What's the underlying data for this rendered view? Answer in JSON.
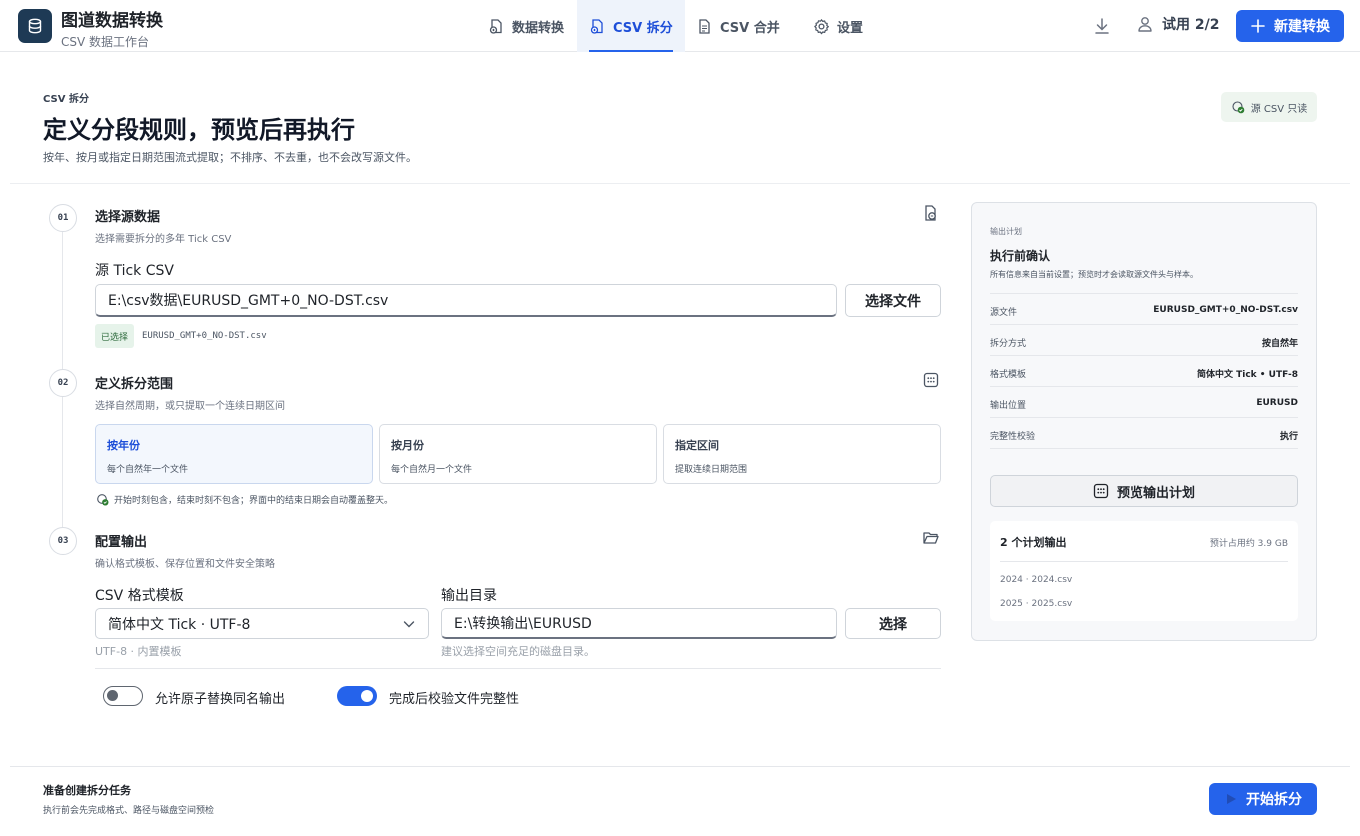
{
  "header": {
    "app_name": "图道数据转换",
    "app_sub": "CSV 数据工作台",
    "tabs": [
      {
        "label": "数据转换",
        "icon": "file-convert-icon"
      },
      {
        "label": "CSV 拆分",
        "icon": "file-split-icon",
        "active": true
      },
      {
        "label": "CSV 合并",
        "icon": "file-merge-icon"
      },
      {
        "label": "设置",
        "icon": "gear-icon"
      }
    ],
    "trial": "试用 2/2",
    "new_button": "新建转换"
  },
  "page": {
    "eyebrow": "CSV 拆分",
    "title": "定义分段规则，预览后再执行",
    "desc": "按年、按月或指定日期范围流式提取；不排序、不去重，也不会改写源文件。",
    "badge": "源 CSV 只读"
  },
  "step1": {
    "num": "01",
    "title": "选择源数据",
    "desc": "选择需要拆分的多年 Tick CSV",
    "field_label": "源 Tick CSV",
    "path_value": "E:\\csv数据\\EURUSD_GMT+0_NO-DST.csv",
    "choose_button": "选择文件",
    "selected_tag": "已选择",
    "selected_file": "EURUSD_GMT+0_NO-DST.csv"
  },
  "step2": {
    "num": "02",
    "title": "定义拆分范围",
    "desc": "选择自然周期，或只提取一个连续日期区间",
    "options": [
      {
        "title": "按年份",
        "desc": "每个自然年一个文件",
        "active": true
      },
      {
        "title": "按月份",
        "desc": "每个自然月一个文件"
      },
      {
        "title": "指定区间",
        "desc": "提取连续日期范围"
      }
    ],
    "note": "开始时刻包含，结束时刻不包含；界面中的结束日期会自动覆盖整天。"
  },
  "step3": {
    "num": "03",
    "title": "配置输出",
    "desc": "确认格式模板、保存位置和文件安全策略",
    "template_label": "CSV 格式模板",
    "template_value": "简体中文 Tick · UTF-8",
    "template_hint": "UTF-8 · 内置模板",
    "dir_label": "输出目录",
    "dir_value": "E:\\转换输出\\EURUSD",
    "dir_button": "选择",
    "dir_hint": "建议选择空间充足的磁盘目录。",
    "toggle1_label": "允许原子替换同名输出",
    "toggle1_on": false,
    "toggle2_label": "完成后校验文件完整性",
    "toggle2_on": true
  },
  "plan": {
    "eyebrow": "输出计划",
    "title": "执行前确认",
    "desc": "所有信息来自当前设置；预览时才会读取源文件头与样本。",
    "rows": [
      {
        "key": "源文件",
        "value": "EURUSD_GMT+0_NO-DST.csv"
      },
      {
        "key": "拆分方式",
        "value": "按自然年"
      },
      {
        "key": "格式模板",
        "value": "简体中文 Tick • UTF-8"
      },
      {
        "key": "输出位置",
        "value": "EURUSD"
      },
      {
        "key": "完整性校验",
        "value": "执行"
      }
    ],
    "preview_button": "预览输出计划",
    "outputs_title": "2 个计划输出",
    "outputs_size": "预计占用约 3.9 GB",
    "outputs": [
      "2024 · 2024.csv",
      "2025 · 2025.csv"
    ]
  },
  "footer": {
    "title": "准备创建拆分任务",
    "desc": "执行前会先完成格式、路径与磁盘空间预检",
    "start_button": "开始拆分"
  },
  "colors": {
    "accent": "#2563eb",
    "brand_logo": "#1e3a55",
    "success": "#2e7d32"
  }
}
